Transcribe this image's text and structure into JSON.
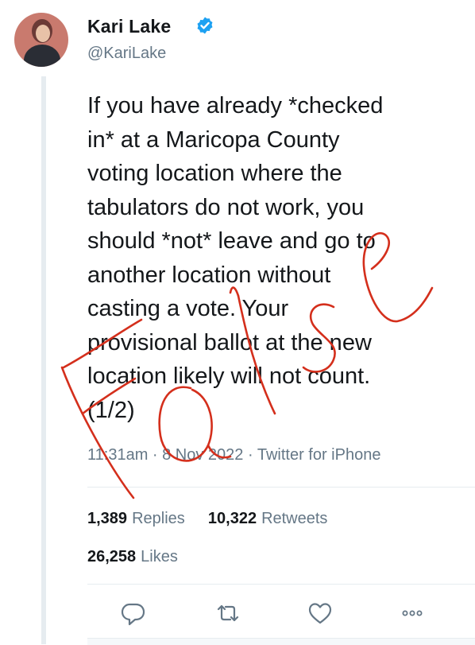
{
  "author": {
    "name": "Kari Lake",
    "handle": "@KariLake",
    "verified_icon": "verified-badge-icon",
    "verified_color": "#1da1f2"
  },
  "tweet": {
    "text": "If you have already *checked\nin* at a Maricopa County\nvoting location where the\ntabulators do not work, you\nshould *not* leave and go to\nanother location without\ncasting a vote.  Your\nprovisional ballot at the new\nlocation likely will not count.\n(1/2)",
    "meta": "11:31am · 8 Nov 2022 · Twitter for iPhone"
  },
  "stats": {
    "replies_count": "1,389",
    "replies_label": "Replies",
    "retweets_count": "10,322",
    "retweets_label": "Retweets",
    "likes_count": "26,258",
    "likes_label": "Likes"
  },
  "actions": [
    "reply-icon",
    "retweet-icon",
    "like-icon",
    "more-icon"
  ],
  "overlay": {
    "annotation_word": "False",
    "ink_color": "#d42f1c"
  }
}
